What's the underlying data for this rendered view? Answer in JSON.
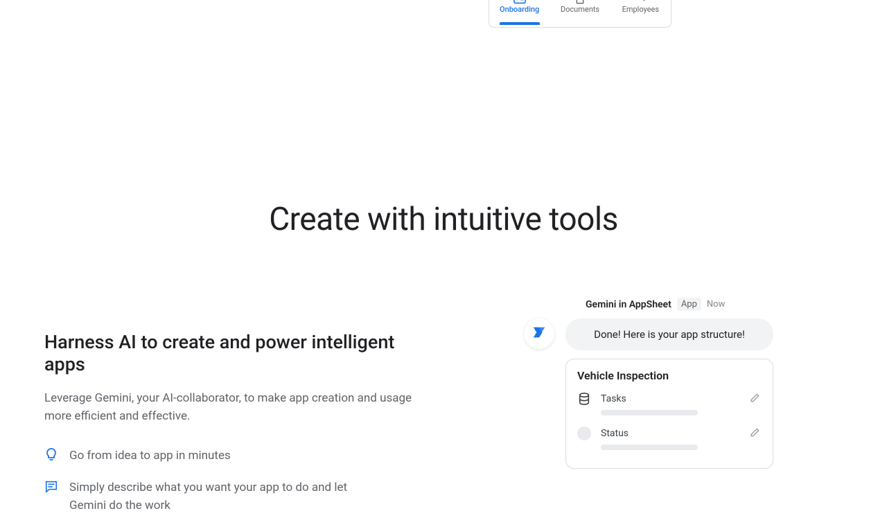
{
  "tabs": [
    {
      "label": "Onboarding",
      "active": true,
      "icon": "id-card"
    },
    {
      "label": "Documents",
      "active": false,
      "icon": "document"
    },
    {
      "label": "Employees",
      "active": false,
      "icon": "checklist"
    }
  ],
  "hero": {
    "heading": "Create with intuitive tools"
  },
  "left": {
    "title": "Harness AI to create and power intelligent apps",
    "lead": "Leverage Gemini, your AI-collaborator, to make app creation and usage more efficient and effective.",
    "bullets": [
      {
        "icon": "lightbulb",
        "text": "Go from idea to app in minutes"
      },
      {
        "icon": "chat",
        "text": "Simply describe what you want your app to do and let Gemini do the work"
      }
    ]
  },
  "gemini": {
    "title": "Gemini in AppSheet",
    "badge": "App",
    "timestamp": "Now",
    "bubble": "Done! Here is your app structure!",
    "card": {
      "title": "Vehicle Inspection",
      "rows": [
        {
          "icon": "database",
          "label": "Tasks"
        },
        {
          "icon": "circle-placeholder",
          "label": "Status"
        }
      ]
    }
  },
  "colors": {
    "blue": "#1a73e8",
    "grey": "#5f6368"
  }
}
